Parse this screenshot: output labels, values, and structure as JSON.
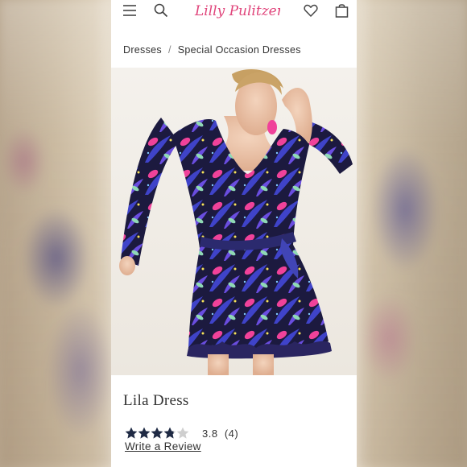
{
  "brand": {
    "logo_text": "Lilly Pulitzer",
    "accent": "#e0457b"
  },
  "nav": {
    "icons": [
      "menu-icon",
      "search-icon",
      "heart-icon",
      "bag-icon"
    ]
  },
  "breadcrumb": {
    "items": [
      "Dresses",
      "Special Occasion Dresses"
    ],
    "separator": "/"
  },
  "product": {
    "title": "Lila Dress",
    "rating_value": "3.8",
    "rating_count": "(4)",
    "rating_stars": 3.8,
    "write_review": "Write a Review"
  }
}
